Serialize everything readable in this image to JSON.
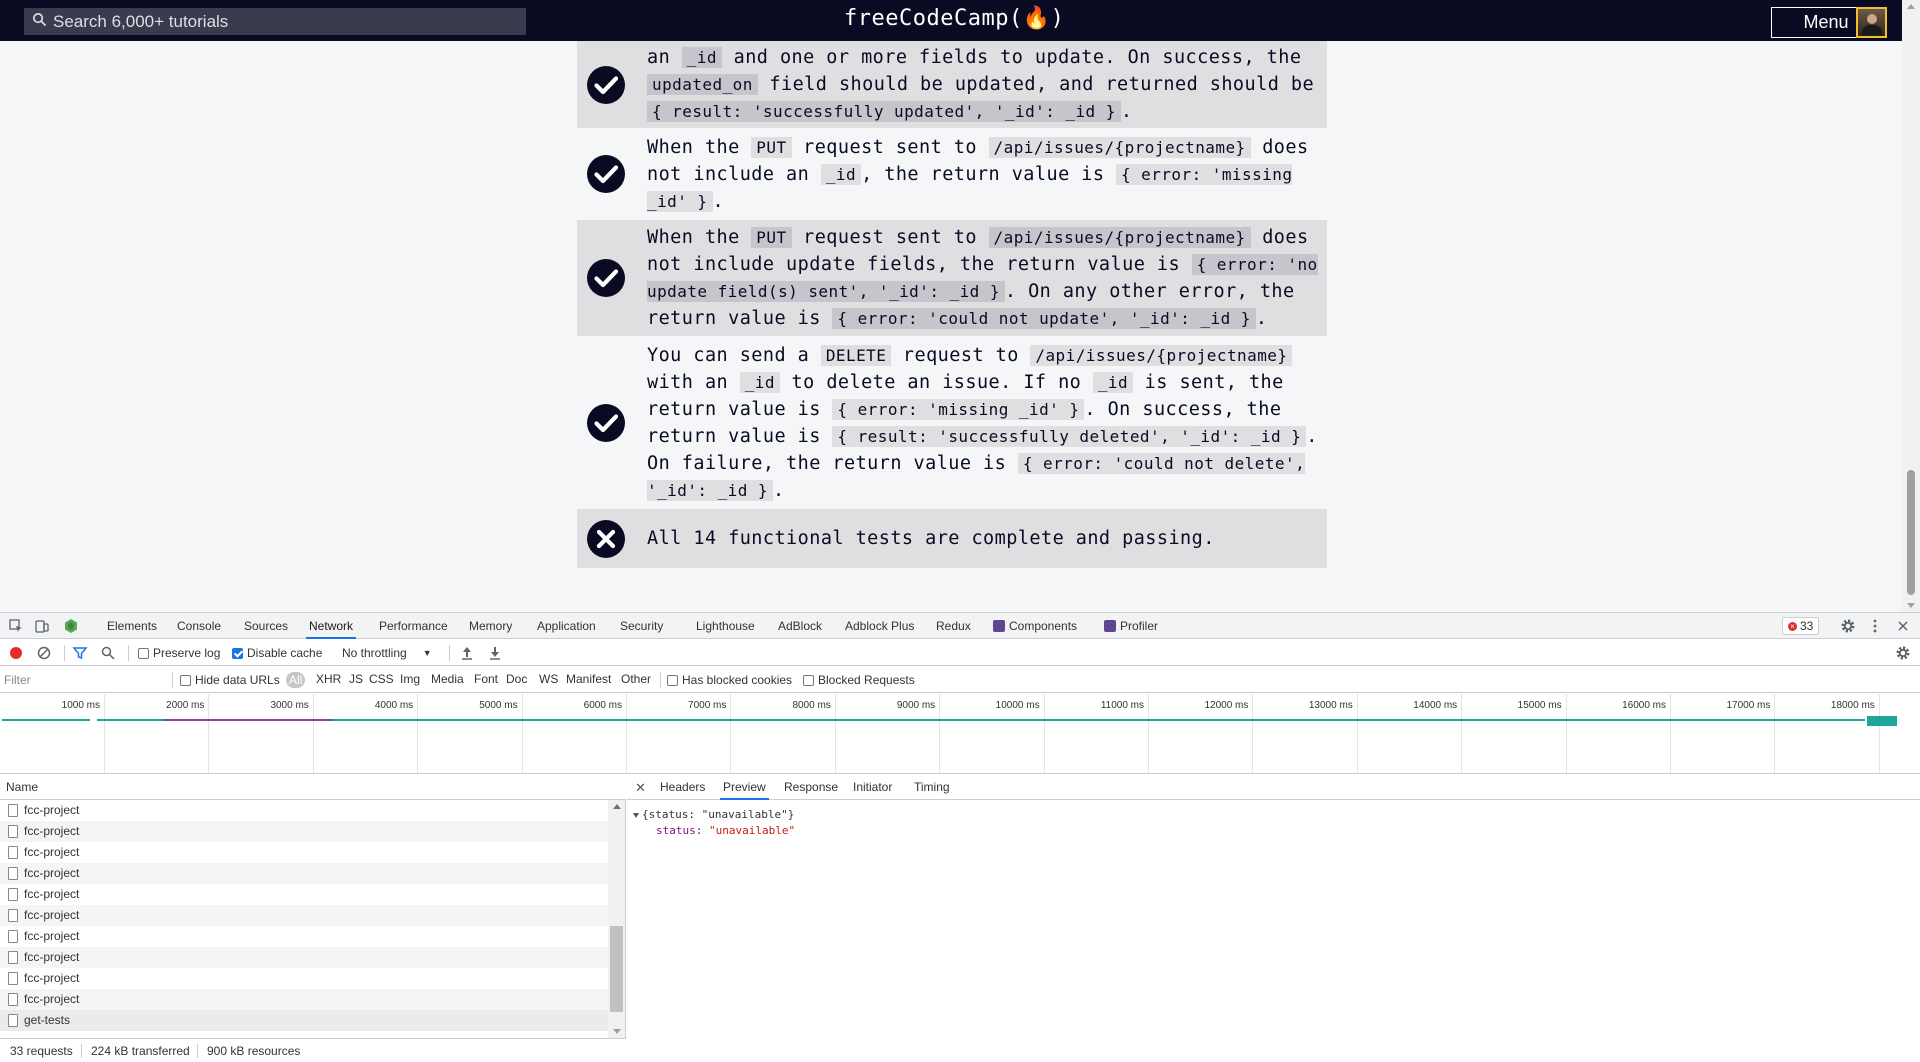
{
  "fcc": {
    "search_placeholder": "Search 6,000+ tutorials",
    "logo": "freeCodeCamp(🔥)",
    "menu_label": "Menu",
    "stories": [
      {
        "status": "passed",
        "parts": [
          {
            "t": "text",
            "v": "an "
          },
          {
            "t": "code",
            "v": "_id"
          },
          {
            "t": "text",
            "v": " and one or more fields to update. On success, the "
          },
          {
            "t": "code",
            "v": "updated_on"
          },
          {
            "t": "text",
            "v": " field should be updated, and returned should be "
          },
          {
            "t": "code",
            "v": "{ result: 'successfully updated', '_id': _id }"
          },
          {
            "t": "text",
            "v": "."
          }
        ]
      },
      {
        "status": "passed",
        "parts": [
          {
            "t": "text",
            "v": "When the "
          },
          {
            "t": "code",
            "v": "PUT"
          },
          {
            "t": "text",
            "v": " request sent to "
          },
          {
            "t": "code",
            "v": "/api/issues/{projectname}"
          },
          {
            "t": "text",
            "v": " does not include an "
          },
          {
            "t": "code",
            "v": "_id"
          },
          {
            "t": "text",
            "v": ", the return value is "
          },
          {
            "t": "code",
            "v": "{ error: 'missing _id' }"
          },
          {
            "t": "text",
            "v": "."
          }
        ]
      },
      {
        "status": "passed",
        "parts": [
          {
            "t": "text",
            "v": "When the "
          },
          {
            "t": "code",
            "v": "PUT"
          },
          {
            "t": "text",
            "v": " request sent to "
          },
          {
            "t": "code",
            "v": "/api/issues/{projectname}"
          },
          {
            "t": "text",
            "v": " does not include update fields, the return value is "
          },
          {
            "t": "code",
            "v": "{ error: 'no update field(s) sent', '_id': _id }"
          },
          {
            "t": "text",
            "v": ". On any other error, the return value is "
          },
          {
            "t": "code",
            "v": "{ error: 'could not update', '_id': _id }"
          },
          {
            "t": "text",
            "v": "."
          }
        ]
      },
      {
        "status": "passed",
        "parts": [
          {
            "t": "text",
            "v": "You can send a "
          },
          {
            "t": "code",
            "v": "DELETE"
          },
          {
            "t": "text",
            "v": " request to "
          },
          {
            "t": "code",
            "v": "/api/issues/{projectname}"
          },
          {
            "t": "text",
            "v": " with an "
          },
          {
            "t": "code",
            "v": "_id"
          },
          {
            "t": "text",
            "v": " to delete an issue. If no "
          },
          {
            "t": "code",
            "v": "_id"
          },
          {
            "t": "text",
            "v": " is sent, the return value is "
          },
          {
            "t": "code",
            "v": "{ error: 'missing _id' }"
          },
          {
            "t": "text",
            "v": ". On success, the return value is "
          },
          {
            "t": "code",
            "v": "{ result: 'successfully deleted', '_id': _id }"
          },
          {
            "t": "text",
            "v": ". On failure, the return value is "
          },
          {
            "t": "code",
            "v": "{ error: 'could not delete', '_id': _id }"
          },
          {
            "t": "text",
            "v": "."
          }
        ]
      },
      {
        "status": "failed",
        "parts": [
          {
            "t": "text",
            "v": "All 14 functional tests are complete and passing."
          }
        ]
      }
    ]
  },
  "devtools": {
    "tabs": [
      "Elements",
      "Console",
      "Sources",
      "Network",
      "Performance",
      "Memory",
      "Application",
      "Security",
      "Lighthouse",
      "AdBlock",
      "Adblock Plus",
      "Redux",
      "Components",
      "Profiler"
    ],
    "active_tab": "Network",
    "error_count": "33",
    "toolbar": {
      "preserve_log": "Preserve log",
      "disable_cache": "Disable cache",
      "throttling": "No throttling"
    },
    "filter": {
      "placeholder": "Filter",
      "hide_data_urls": "Hide data URLs",
      "types": [
        "All",
        "XHR",
        "JS",
        "CSS",
        "Img",
        "Media",
        "Font",
        "Doc",
        "WS",
        "Manifest",
        "Other"
      ],
      "has_blocked_cookies": "Has blocked cookies",
      "blocked_requests": "Blocked Requests"
    },
    "timeline_ticks": [
      "1000 ms",
      "2000 ms",
      "3000 ms",
      "4000 ms",
      "5000 ms",
      "6000 ms",
      "7000 ms",
      "8000 ms",
      "9000 ms",
      "10000 ms",
      "11000 ms",
      "12000 ms",
      "13000 ms",
      "14000 ms",
      "15000 ms",
      "16000 ms",
      "17000 ms",
      "18000 ms"
    ],
    "name_header": "Name",
    "requests": [
      "fcc-project",
      "fcc-project",
      "fcc-project",
      "fcc-project",
      "fcc-project",
      "fcc-project",
      "fcc-project",
      "fcc-project",
      "fcc-project",
      "fcc-project",
      "get-tests"
    ],
    "status_bar": {
      "requests": "33 requests",
      "transferred": "224 kB transferred",
      "resources": "900 kB resources"
    },
    "detail_tabs": [
      "Headers",
      "Preview",
      "Response",
      "Initiator",
      "Timing"
    ],
    "active_detail_tab": "Preview",
    "preview": {
      "summary": "{status: \"unavailable\"}",
      "key": "status",
      "value": "\"unavailable\""
    }
  },
  "colors": {
    "fcc_nav": "#0a0a23",
    "story_shade": "#dfdfe2",
    "devtools_accent": "#1a73e8",
    "error_red": "#e12e2e"
  }
}
